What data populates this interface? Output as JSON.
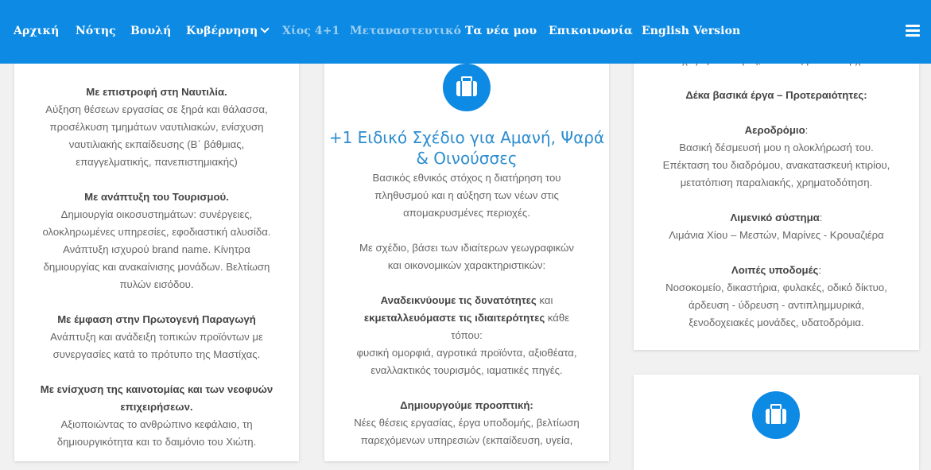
{
  "nav": {
    "items": [
      {
        "label": "Αρχική"
      },
      {
        "label": "Νότης"
      },
      {
        "label": "Βουλή"
      },
      {
        "label": "Κυβέρνηση"
      },
      {
        "label": "Χίος 4+1"
      },
      {
        "label": "Μεταναστευτικό"
      },
      {
        "label": "Τα νέα μου"
      },
      {
        "label": "Επικοινωνία"
      },
      {
        "label": "English Version"
      }
    ],
    "icons": {
      "dropdown": "chevron-down-icon",
      "menu": "hamburger-menu-icon"
    }
  },
  "left": {
    "s1_title": "Με επιστροφή στη Ναυτιλία.",
    "s1_l1": "Αύξηση θέσεων εργασίας σε ξηρά και θάλασσα,",
    "s1_l2": "προσέλκυση τμημάτων ναυτιλιακών, ενίσχυση",
    "s1_l3": "ναυτιλιακής εκπαίδευσης (Β΄ βάθμιας,",
    "s1_l4": "επαγγελματικής, πανεπιστημιακής)",
    "s2_title": "Με ανάπτυξη του Τουρισμού.",
    "s2_l1": "Δημιουργία οικοσυστημάτων: συνέργειες,",
    "s2_l2": "ολοκληρωμένες υπηρεσίες, εφοδιαστική αλυσίδα.",
    "s2_l3": "Ανάπτυξη ισχυρού brand name. Κίνητρα",
    "s2_l4": "δημιουργίας και ανακαίνισης μονάδων. Βελτίωση",
    "s2_l5": "πυλών εισόδου.",
    "s3_title": "Με έμφαση στην Πρωτογενή Παραγωγή",
    "s3_l1": "Ανάπτυξη και ανάδειξη τοπικών προϊόντων με",
    "s3_l2": "συνεργασίες κατά το πρότυπο της Μαστίχας.",
    "s4_title1": "Με ενίσχυση της καινοτομίας και των νεοφυών",
    "s4_title2": "επιχειρήσεων.",
    "s4_l1": "Αξιοποιώντας το ανθρώπινο κεφάλαιο, τη",
    "s4_l2": "δημιουργικότητα και το δαιμόνιο του Χιώτη."
  },
  "center": {
    "icon": "briefcase-icon",
    "title1": "+1 Ειδικό Σχέδιο για Αμανή, Ψαρά",
    "title2": "& Οινούσσες",
    "p1_l1": "Βασικός εθνικός στόχος η διατήρηση του",
    "p1_l2": "πληθυσμού και η αύξηση των νέων στις",
    "p1_l3": "απομακρυσμένες περιοχές.",
    "p2_l1": "Με σχέδιο, βάσει των ιδιαίτερων γεωγραφικών",
    "p2_l2": "και οικονομικών χαρακτηριστικών:",
    "p3_b1": "Αναδεικνύουμε τις δυνατότητες",
    "p3_t1": " και",
    "p3_b2": "εκμεταλλευόμαστε τις ιδιαιτερότητες",
    "p3_t2": " κάθε",
    "p3_l3": "τόπου:",
    "p3_l4": "φυσική ομορφιά, αγροτικά προϊόντα, αξιοθέατα,",
    "p3_l5": "εναλλακτικός τουρισμός, ιαματικές πηγές.",
    "p4_title": "Δημιουργούμε προοπτική:",
    "p4_l1": "Νέες θέσεις εργασίας, έργα υποδομής, βελτίωση",
    "p4_l2": "παρεχόμενων υπηρεσιών (εκπαίδευση, υγεία,"
  },
  "right": {
    "cut_line": "χωρίς υποδομές, ανάπτυξη δεν υπάρχει.",
    "heading": "Δέκα βασικά έργα – Προτεραιότητες:",
    "airport_title": "Αεροδρόμιο",
    "airport_l1": "Βασική δέσμευσή μου η ολοκλήρωσή του.",
    "airport_l2": "Επέκταση του διαδρόμου, ανακατασκευή κτιρίου,",
    "airport_l3": "μετατόπιση παραλιακής, χρηματοδότηση.",
    "port_title": "Λιμενικό σύστημα",
    "port_l1": "Λιμάνια Χίου – Μεστών, Μαρίνες - Κρουαζιέρα",
    "infra_title": "Λοιπές υποδομές",
    "infra_l1": "Νοσοκομείο, δικαστήρια, φυλακές, οδικό δίκτυο,",
    "infra_l2": "άρδευση - ύδρευση - αντιπλημμυρικά,",
    "infra_l3": "ξενοδοχειακές μονάδες, υδατοδρόμια.",
    "colon": ":",
    "icon2": "briefcase-icon"
  }
}
